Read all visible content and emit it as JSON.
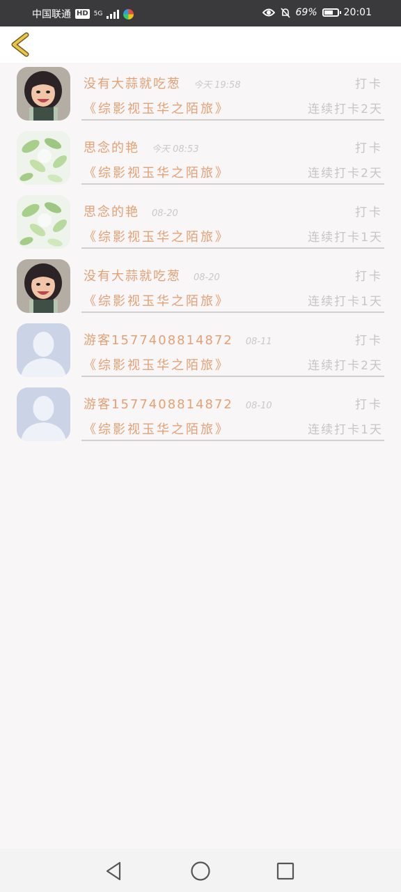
{
  "status_bar": {
    "carrier": "中国联通",
    "hd": "HD",
    "network": "5G",
    "battery_percent": "69%",
    "battery_level": 0.69,
    "time": "20:01"
  },
  "header": {
    "back_icon": "chevron-left-icon"
  },
  "checkins": [
    {
      "user": "没有大蒜就吃葱",
      "time": "今天 19:58",
      "action": "打卡",
      "book": "《综影视玉华之陌旅》",
      "streak": "连续打卡2天",
      "avatar": "cartoon-girl"
    },
    {
      "user": "思念的艳",
      "time": "今天 08:53",
      "action": "打卡",
      "book": "《综影视玉华之陌旅》",
      "streak": "连续打卡2天",
      "avatar": "green-leaves"
    },
    {
      "user": "思念的艳",
      "time": "08-20",
      "action": "打卡",
      "book": "《综影视玉华之陌旅》",
      "streak": "连续打卡1天",
      "avatar": "green-leaves"
    },
    {
      "user": "没有大蒜就吃葱",
      "time": "08-20",
      "action": "打卡",
      "book": "《综影视玉华之陌旅》",
      "streak": "连续打卡1天",
      "avatar": "cartoon-girl"
    },
    {
      "user": "游客1577408814872",
      "time": "08-11",
      "action": "打卡",
      "book": "《综影视玉华之陌旅》",
      "streak": "连续打卡2天",
      "avatar": "default-person"
    },
    {
      "user": "游客1577408814872",
      "time": "08-10",
      "action": "打卡",
      "book": "《综影视玉华之陌旅》",
      "streak": "连续打卡1天",
      "avatar": "default-person"
    }
  ],
  "nav": {
    "back": "triangle-back-icon",
    "home": "circle-home-icon",
    "recents": "square-recents-icon"
  },
  "colors": {
    "accent": "#e5a073",
    "muted": "#c6c6c6",
    "back_arrow": "#e8c64a"
  }
}
